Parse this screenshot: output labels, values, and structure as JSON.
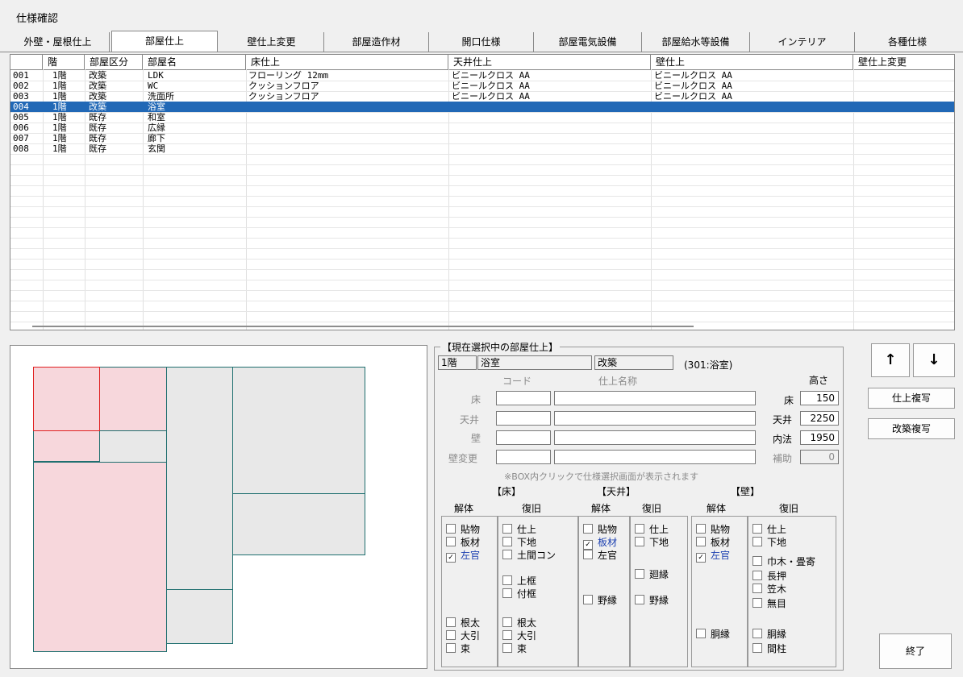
{
  "window_title": "仕様確認",
  "tabs": [
    "外壁・屋根仕上",
    "部屋仕上",
    "壁仕上変更",
    "部屋造作材",
    "開口仕様",
    "部屋電気設備",
    "部屋給水等設備",
    "インテリア",
    "各種仕様"
  ],
  "table": {
    "headers": [
      "",
      "階",
      "部屋区分",
      "部屋名",
      "床仕上",
      "天井仕上",
      "壁仕上",
      "壁仕上変更"
    ],
    "rows": [
      {
        "no": "001",
        "floor": "1階",
        "kubun": "改築",
        "name": "LDK",
        "yuka": "フローリング 12mm",
        "tenjo": "ビニールクロス AA",
        "kabe": "ビニールクロス AA",
        "henko": ""
      },
      {
        "no": "002",
        "floor": "1階",
        "kubun": "改築",
        "name": "WC",
        "yuka": "クッションフロア",
        "tenjo": "ビニールクロス AA",
        "kabe": "ビニールクロス AA",
        "henko": ""
      },
      {
        "no": "003",
        "floor": "1階",
        "kubun": "改築",
        "name": "洗面所",
        "yuka": "クッションフロア",
        "tenjo": "ビニールクロス AA",
        "kabe": "ビニールクロス AA",
        "henko": ""
      },
      {
        "no": "004",
        "floor": "1階",
        "kubun": "改築",
        "name": "浴室",
        "yuka": "",
        "tenjo": "",
        "kabe": "",
        "henko": ""
      },
      {
        "no": "005",
        "floor": "1階",
        "kubun": "既存",
        "name": "和室",
        "yuka": "",
        "tenjo": "",
        "kabe": "",
        "henko": ""
      },
      {
        "no": "006",
        "floor": "1階",
        "kubun": "既存",
        "name": "広縁",
        "yuka": "",
        "tenjo": "",
        "kabe": "",
        "henko": ""
      },
      {
        "no": "007",
        "floor": "1階",
        "kubun": "既存",
        "name": "廊下",
        "yuka": "",
        "tenjo": "",
        "kabe": "",
        "henko": ""
      },
      {
        "no": "008",
        "floor": "1階",
        "kubun": "既存",
        "name": "玄関",
        "yuka": "",
        "tenjo": "",
        "kabe": "",
        "henko": ""
      }
    ],
    "selected_index": 3
  },
  "panel": {
    "title": "【現在選択中の部屋仕上】",
    "floor": "1階",
    "room": "浴室",
    "kubun": "改築",
    "code_note": "(301:浴室)",
    "col_code": "コード",
    "col_name": "仕上名称",
    "row_labels": [
      "床",
      "天井",
      "壁",
      "壁変更"
    ],
    "height_header": "高さ",
    "height_labels": [
      "床",
      "天井",
      "内法",
      "補助"
    ],
    "height_values": [
      "150",
      "2250",
      "1950",
      "0"
    ],
    "hint": "※BOX内クリックで仕様選択画面が表示されます",
    "sections": [
      "【床】",
      "【天井】",
      "【壁】"
    ],
    "kaitai": "解体",
    "fukkyu": "復旧"
  },
  "checks": {
    "yuka_kaitai": [
      {
        "label": "貼物",
        "checked": false
      },
      {
        "label": "板材",
        "checked": false
      },
      {
        "label": "左官",
        "checked": true
      },
      {
        "label": "根太",
        "checked": false
      },
      {
        "label": "大引",
        "checked": false
      },
      {
        "label": "束",
        "checked": false
      }
    ],
    "yuka_fukkyu": [
      {
        "label": "仕上",
        "checked": false
      },
      {
        "label": "下地",
        "checked": false
      },
      {
        "label": "土間コン",
        "checked": false
      },
      {
        "label": "上框",
        "checked": false
      },
      {
        "label": "付框",
        "checked": false
      },
      {
        "label": "根太",
        "checked": false
      },
      {
        "label": "大引",
        "checked": false
      },
      {
        "label": "束",
        "checked": false
      }
    ],
    "tenjo_kaitai": [
      {
        "label": "貼物",
        "checked": false
      },
      {
        "label": "板材",
        "checked": true
      },
      {
        "label": "左官",
        "checked": false
      },
      {
        "label": "野縁",
        "checked": false
      }
    ],
    "tenjo_fukkyu": [
      {
        "label": "仕上",
        "checked": false
      },
      {
        "label": "下地",
        "checked": false
      },
      {
        "label": "廻縁",
        "checked": false
      },
      {
        "label": "野縁",
        "checked": false
      }
    ],
    "kabe_kaitai": [
      {
        "label": "貼物",
        "checked": false
      },
      {
        "label": "板材",
        "checked": false
      },
      {
        "label": "左官",
        "checked": true
      },
      {
        "label": "胴縁",
        "checked": false
      }
    ],
    "kabe_fukkyu": [
      {
        "label": "仕上",
        "checked": false
      },
      {
        "label": "下地",
        "checked": false
      },
      {
        "label": "巾木・畳寄",
        "checked": false
      },
      {
        "label": "長押",
        "checked": false
      },
      {
        "label": "笠木",
        "checked": false
      },
      {
        "label": "無目",
        "checked": false
      },
      {
        "label": "胴縁",
        "checked": false
      },
      {
        "label": "間柱",
        "checked": false
      }
    ]
  },
  "buttons": {
    "up": "↑",
    "down": "↓",
    "copy": "仕上複写",
    "copy_kaichiku": "改築複写",
    "close": "終了"
  },
  "colors": {
    "selection": "#2168b6",
    "room_fill": "#f7d7dc",
    "room_selected": "#e02020",
    "room_stroke": "#1f6f6f",
    "existing_fill": "#e8e8e8"
  }
}
